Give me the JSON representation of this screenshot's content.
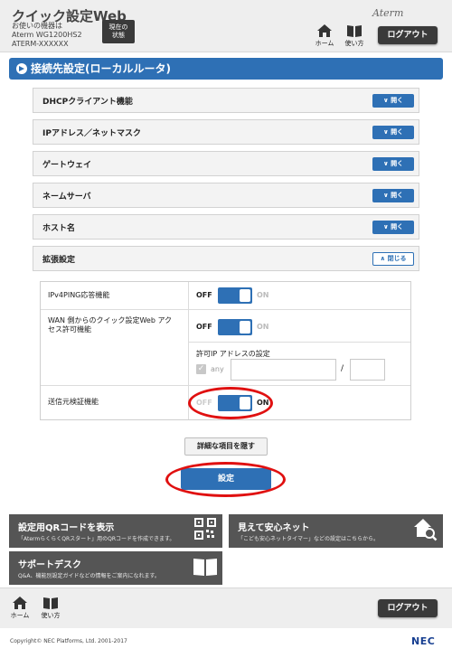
{
  "header": {
    "app_title": "クイック設定Web",
    "model_line1": "お使いの機器は",
    "model_line2": "Aterm WG1200HS2",
    "model_line3": "ATERM-XXXXXX",
    "status_button_line1": "現在の",
    "status_button_line2": "状態",
    "brand": "Aterm",
    "home_label": "ホーム",
    "help_label": "使い方",
    "logout_label": "ログアウト"
  },
  "section": {
    "title": "接続先設定(ローカルルータ)"
  },
  "accordions": [
    {
      "label": "DHCPクライアント機能",
      "button": "開く"
    },
    {
      "label": "IPアドレス／ネットマスク",
      "button": "開く"
    },
    {
      "label": "ゲートウェイ",
      "button": "開く"
    },
    {
      "label": "ネームサーバ",
      "button": "開く"
    },
    {
      "label": "ホスト名",
      "button": "開く"
    },
    {
      "label": "拡張設定",
      "button": "閉じる"
    }
  ],
  "extended": {
    "ping_label": "IPv4PING応答機能",
    "ping_state": "OFF",
    "wan_label_line1": "WAN 側からのクイック設定Web アク",
    "wan_label_line2": "セス許可機能",
    "wan_state": "OFF",
    "allowed_ip_label": "許可IP アドレスの設定",
    "any_label": "any",
    "any_checked": true,
    "ip_value": "",
    "mask_value": "",
    "slash": "/",
    "source_check_label": "送信元検証機能",
    "source_check_state": "ON",
    "off_text": "OFF",
    "on_text": "ON"
  },
  "buttons": {
    "hide_details": "詳細な項目を隠す",
    "apply": "設定"
  },
  "panels": {
    "qr_title": "設定用QRコードを表示",
    "qr_desc": "「AtermらくらくQRスタート」用のQRコードを作成できます。",
    "safe_title": "見えて安心ネット",
    "safe_desc": "「こども安心ネットタイマー」などの設定はこちらから。",
    "support_title": "サポートデスク",
    "support_desc": "Q&A、機能別設定ガイドなどの情報をご案内になれます。"
  },
  "footer": {
    "home_label": "ホーム",
    "help_label": "使い方",
    "logout_label": "ログアウト",
    "copyright": "Copyright© NEC Platforms, Ltd. 2001-2017",
    "brand": "NEC"
  },
  "colors": {
    "accent": "#2e70b5",
    "panel": "#555555",
    "highlight_ring": "#e01010"
  }
}
